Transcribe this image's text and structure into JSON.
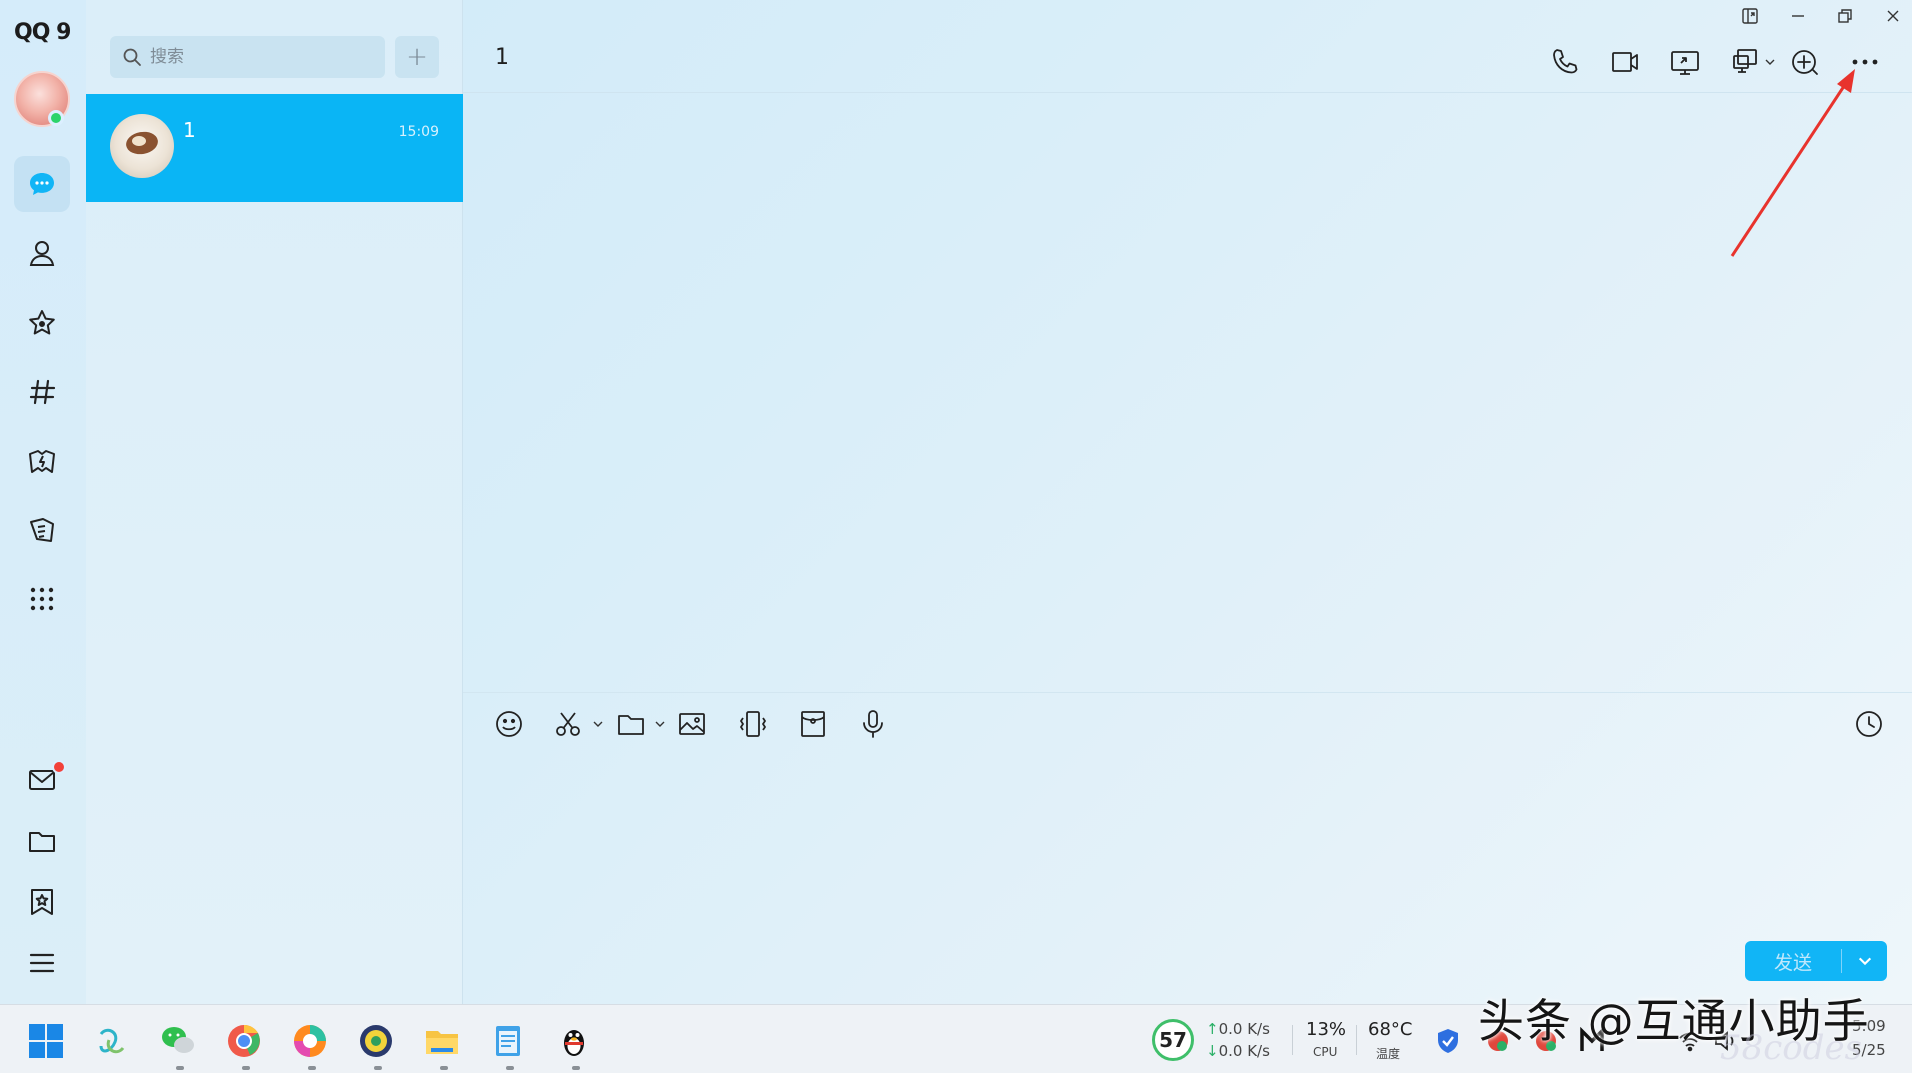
{
  "app": {
    "logo": "QQ 9",
    "status": "online"
  },
  "rail": {
    "items": [
      {
        "name": "messages",
        "active": true
      },
      {
        "name": "contacts"
      },
      {
        "name": "favorites"
      },
      {
        "name": "channels"
      },
      {
        "name": "games"
      },
      {
        "name": "news"
      },
      {
        "name": "apps"
      }
    ],
    "bottom": [
      {
        "name": "mail",
        "badge": true
      },
      {
        "name": "files"
      },
      {
        "name": "bookmarks"
      },
      {
        "name": "menu"
      }
    ]
  },
  "search": {
    "placeholder": "搜索"
  },
  "add_button": "+",
  "conversations": [
    {
      "name": "1",
      "time": "15:09",
      "selected": true
    }
  ],
  "chat": {
    "title": "1",
    "send_label": "发送"
  },
  "taskbar": {
    "score": "57",
    "net_up": "0.0 K/s",
    "net_down": "0.0 K/s",
    "cpu_value": "13%",
    "cpu_label": "CPU",
    "temp_value": "68°C",
    "temp_label": "温度",
    "clock_time": "5:09",
    "clock_date": "5/25"
  },
  "watermark": {
    "text": "头条 @互通小助手",
    "faint": "58codes"
  },
  "colors": {
    "accent": "#0ab5f5",
    "send": "#11b5f6",
    "badge": "#f2413a",
    "online": "#2bd46a",
    "annotation": "#e8332d"
  }
}
